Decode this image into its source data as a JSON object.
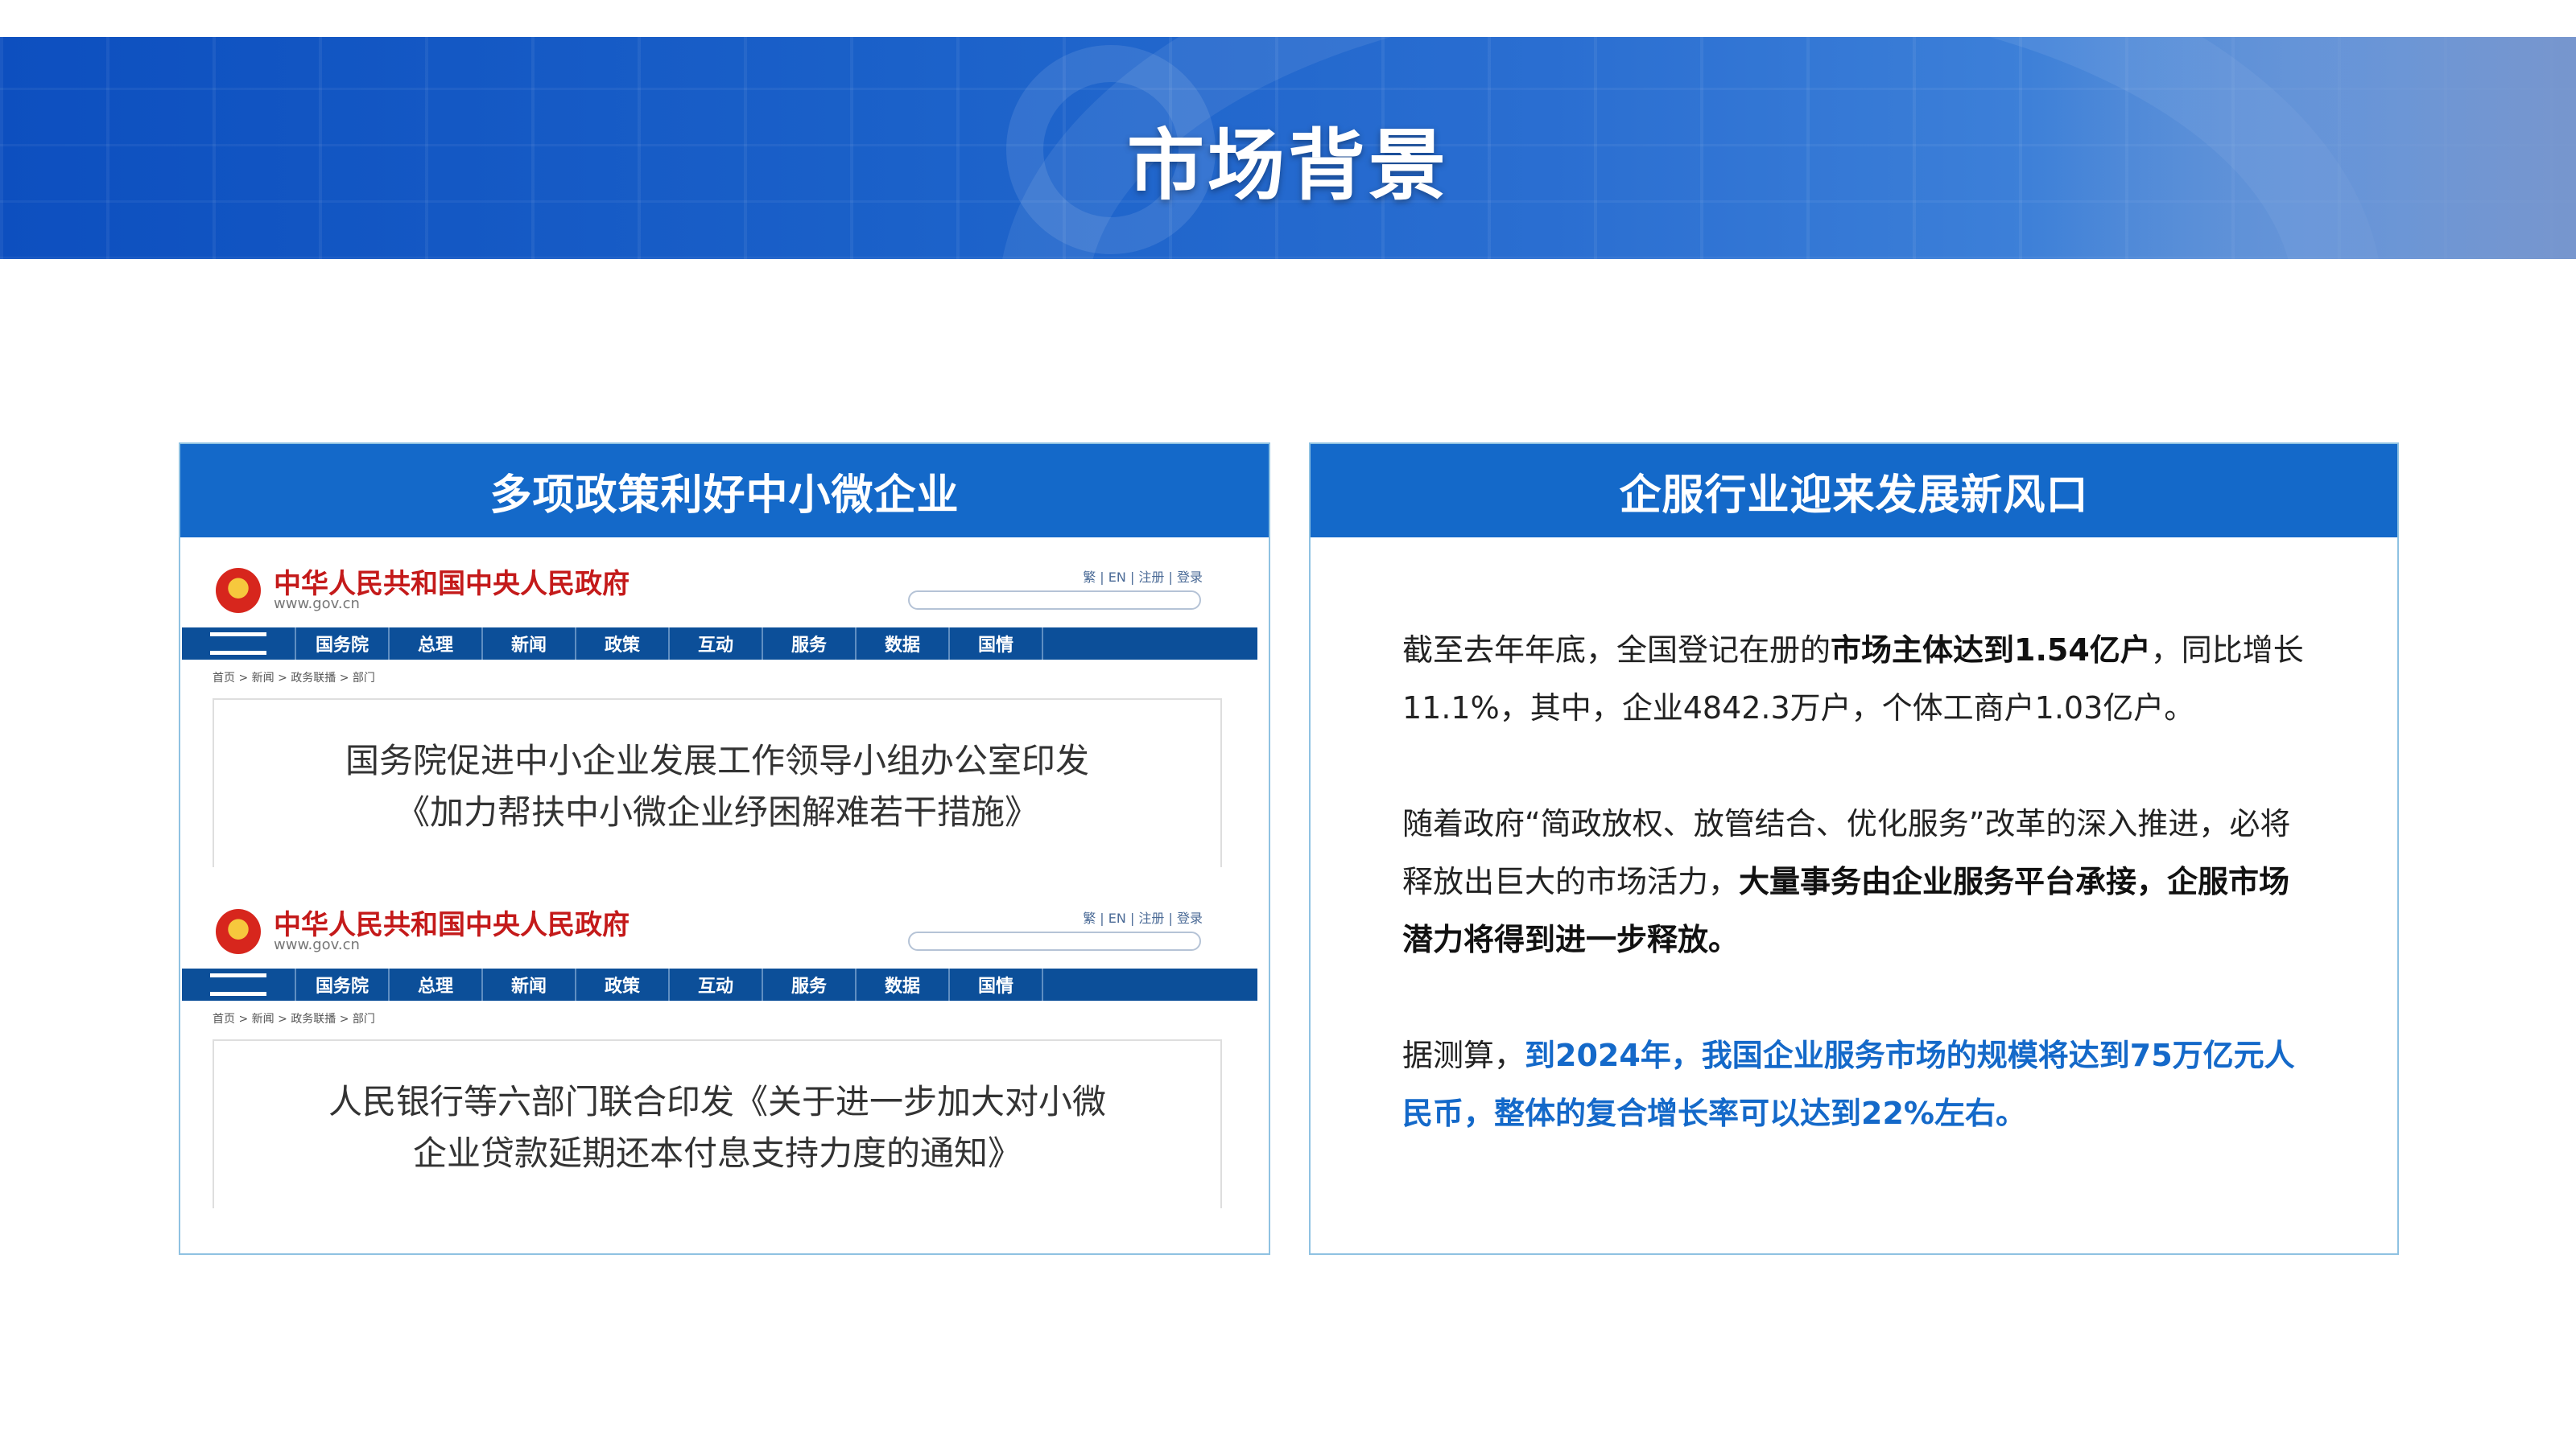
{
  "banner": {
    "title": "市场背景"
  },
  "left_panel": {
    "heading": "多项政策利好中小微企业",
    "screens": [
      {
        "site": "中华人民共和国中央人民政府",
        "url": "www.gov.cn",
        "tools": "繁 | EN | 注册 | 登录",
        "nav": [
          "国务院",
          "总理",
          "新闻",
          "政策",
          "互动",
          "服务",
          "数据",
          "国情"
        ],
        "crumb": "首页 > 新闻 > 政务联播 > 部门",
        "notice_line1": "国务院促进中小企业发展工作领导小组办公室印发",
        "notice_line2": "《加力帮扶中小微企业纾困解难若干措施》"
      },
      {
        "site": "中华人民共和国中央人民政府",
        "url": "www.gov.cn",
        "tools": "繁 | EN | 注册 | 登录",
        "nav": [
          "国务院",
          "总理",
          "新闻",
          "政策",
          "互动",
          "服务",
          "数据",
          "国情"
        ],
        "crumb": "首页 > 新闻 > 政务联播 > 部门",
        "notice_line1": "人民银行等六部门联合印发《关于进一步加大对小微",
        "notice_line2": "企业贷款延期还本付息支持力度的通知》"
      }
    ]
  },
  "right_panel": {
    "heading": "企服行业迎来发展新风口",
    "p1_a": "截至去年年底，全国登记在册的",
    "p1_b": "市场主体达到1.54亿户",
    "p1_c": "，同比增长11.1%，其中，企业4842.3万户，个体工商户1.03亿户。",
    "p2_a": "随着政府“简政放权、放管结合、优化服务”改革的深入推进，必将释放出巨大的市场活力，",
    "p2_b": "大量事务由企业服务平台承接，企服市场潜力将得到进一步释放。",
    "p3_a": "据测算，",
    "p3_b": "到2024年，我国企业服务市场的规模将达到75万亿元人民币，整体的复合增长率可以达到22%左右。"
  },
  "colors": {
    "accent": "#1469c9",
    "gov_red": "#c41a1a",
    "gov_nav": "#0c4f99"
  }
}
